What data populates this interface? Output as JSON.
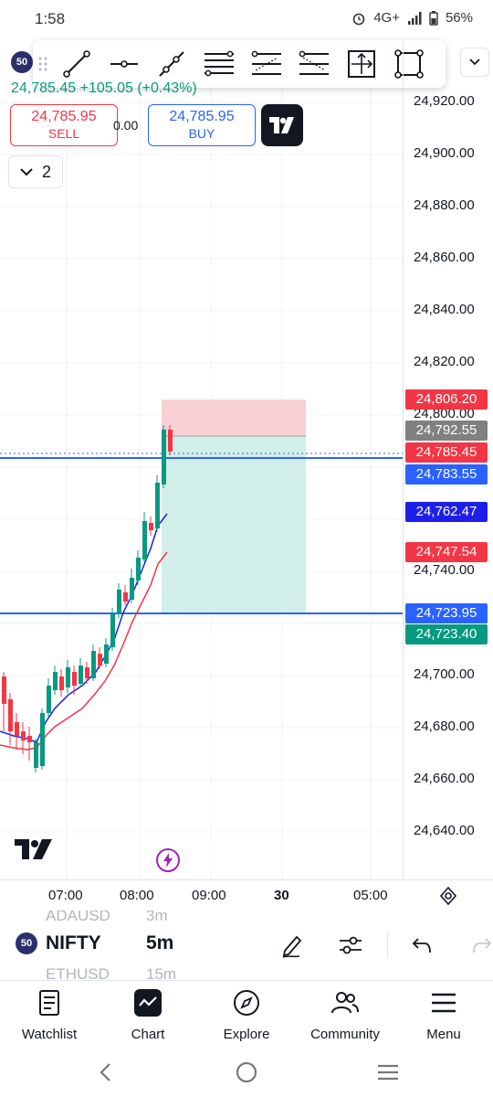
{
  "status_bar": {
    "time": "1:58",
    "network": "4G+",
    "battery": "56%"
  },
  "header": {
    "symbol_badge": "50",
    "quote_line": "24,785.45 +105.05 (+0.43%)",
    "sell_price": "24,785.95",
    "sell_label": "SELL",
    "spread": "0.00",
    "buy_price": "24,785.95",
    "buy_label": "BUY",
    "indicators_count": "2"
  },
  "price_scale": {
    "labels": [
      "24,920.00",
      "24,900.00",
      "24,880.00",
      "24,860.00",
      "24,840.00",
      "24,820.00",
      "24,800.00",
      "24,740.00",
      "24,700.00",
      "24,680.00",
      "24,660.00",
      "24,640.00"
    ],
    "tags": [
      {
        "text": "24,806.20",
        "color": "#f23645"
      },
      {
        "text": "24,792.55",
        "color": "#808080"
      },
      {
        "text": "24,785.45",
        "color": "#f23645"
      },
      {
        "text": "24,783.55",
        "color": "#2962ff"
      },
      {
        "text": "24,762.47",
        "color": "#1e1ee8"
      },
      {
        "text": "24,747.54",
        "color": "#f23645"
      },
      {
        "text": "24,723.95",
        "color": "#2962ff"
      },
      {
        "text": "24,723.40",
        "color": "#089981"
      }
    ]
  },
  "time_axis": {
    "labels": [
      "07:00",
      "08:00",
      "09:00",
      "30",
      "05:00"
    ]
  },
  "symbol_bar": {
    "ghost_top": [
      "ADAUSD",
      "3m"
    ],
    "ghost_bottom": [
      "ETHUSD",
      "15m"
    ],
    "badge": "50",
    "symbol": "NIFTY",
    "timeframe": "5m"
  },
  "bottom_nav": {
    "items": [
      {
        "label": "Watchlist"
      },
      {
        "label": "Chart"
      },
      {
        "label": "Explore"
      },
      {
        "label": "Community"
      },
      {
        "label": "Menu"
      }
    ]
  },
  "colors": {
    "up": "#089981",
    "down": "#f23645",
    "accent": "#2962ff"
  }
}
